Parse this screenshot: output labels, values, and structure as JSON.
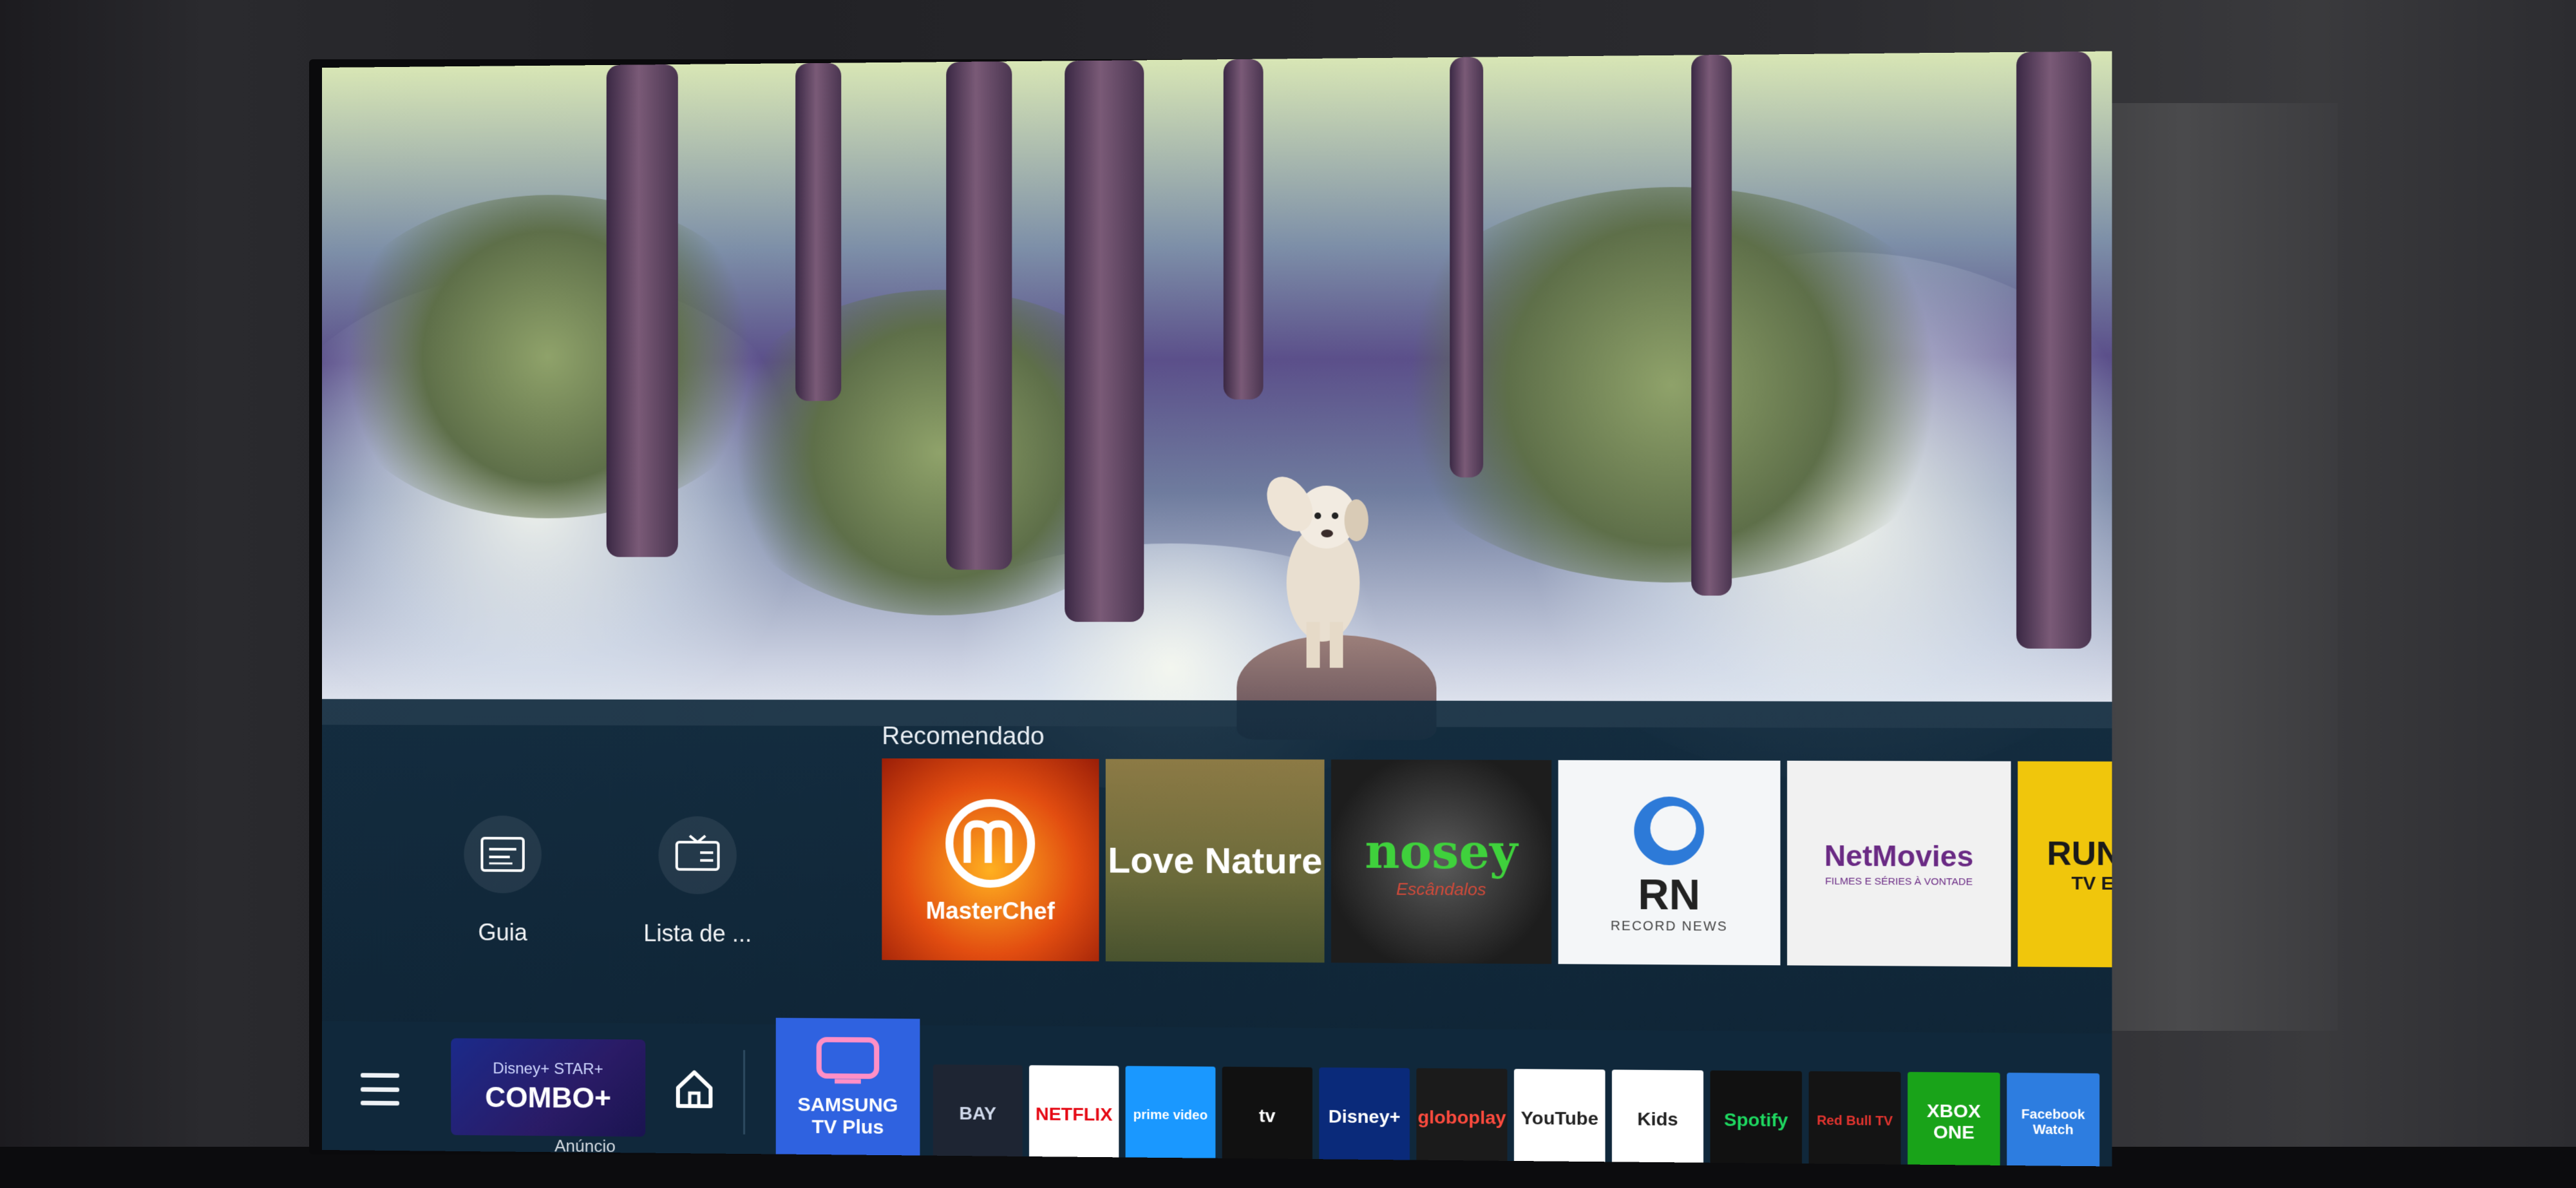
{
  "recommended": {
    "title": "Recomendado",
    "tiles": [
      {
        "name": "MasterChef",
        "label": "MasterChef",
        "bg": "#e04e12"
      },
      {
        "name": "Love Nature",
        "label": "Love Nature",
        "bg": "#7a6e3a"
      },
      {
        "name": "nosey",
        "label": "nosey",
        "sub": "Escândalos",
        "bg": "#2b2b2b"
      },
      {
        "name": "RN Record News",
        "label": "RN",
        "sub": "RECORD NEWS",
        "bg": "#f4f6f8"
      },
      {
        "name": "NetMovies",
        "label": "NetMovies",
        "sub": "FILMES E SÉRIES À VONTADE",
        "bg": "#f1f1f1"
      },
      {
        "name": "Runtime",
        "label": "RUN:TIME",
        "sub": "TV E FILMES",
        "bg": "#f0c60c"
      }
    ]
  },
  "quick_actions": [
    {
      "label": "Guia",
      "icon": "guide-icon"
    },
    {
      "label": "Lista de ...",
      "icon": "channel-list-icon"
    }
  ],
  "bottom_bar": {
    "ad": {
      "brand": "Disney+ STAR+",
      "title": "COMBO+",
      "label": "Anúncio"
    },
    "samsung_tv_plus": {
      "line1": "SAMSUNG",
      "line2": "TV Plus"
    },
    "apps": [
      {
        "label": "BAY",
        "bg": "#1e2533",
        "fg": "#cfd8ea"
      },
      {
        "label": "NETFLIX",
        "bg": "#ffffff",
        "fg": "#e50914"
      },
      {
        "label": "prime video",
        "bg": "#1a98ff",
        "fg": "#ffffff"
      },
      {
        "label": "tv",
        "bg": "#111111",
        "fg": "#ffffff"
      },
      {
        "label": "Disney+",
        "bg": "#0a2a7a",
        "fg": "#ffffff"
      },
      {
        "label": "globoplay",
        "bg": "#1b1b1b",
        "fg": "#ff4b3e"
      },
      {
        "label": "YouTube",
        "bg": "#ffffff",
        "fg": "#222222"
      },
      {
        "label": "Kids",
        "bg": "#ffffff",
        "fg": "#222222"
      },
      {
        "label": "Spotify",
        "bg": "#111111",
        "fg": "#1ed760"
      },
      {
        "label": "Red Bull TV",
        "bg": "#141414",
        "fg": "#e3342f"
      },
      {
        "label": "XBOX ONE",
        "bg": "#19a319",
        "fg": "#ffffff"
      },
      {
        "label": "Facebook Watch",
        "bg": "#2d7de0",
        "fg": "#ffffff"
      }
    ]
  }
}
